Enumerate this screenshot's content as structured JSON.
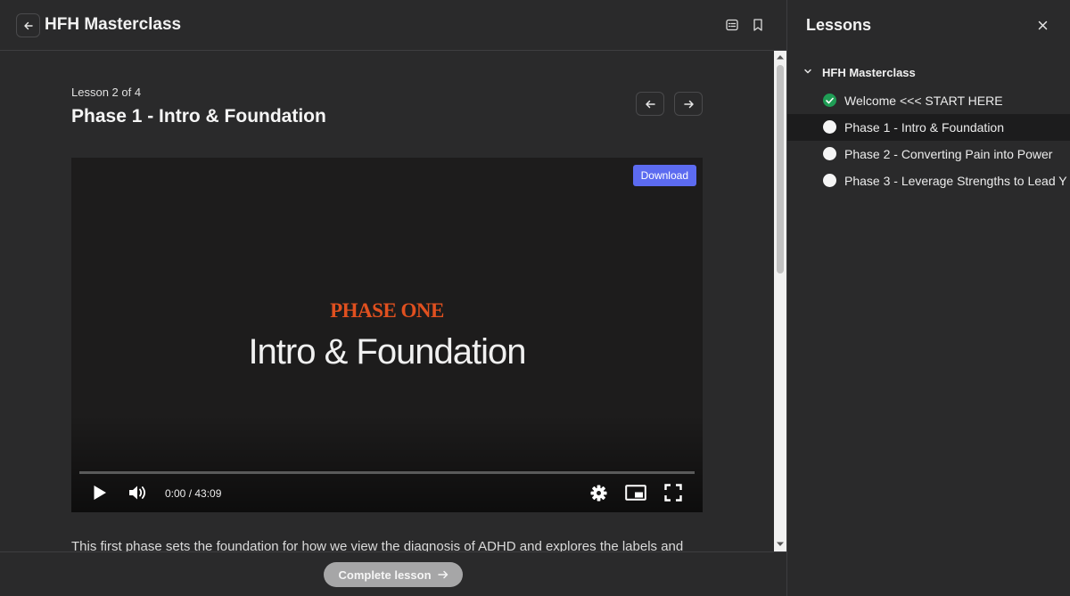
{
  "header": {
    "course_title": "HFH Masterclass"
  },
  "lesson": {
    "counter": "Lesson 2 of 4",
    "title": "Phase 1 - Intro & Foundation",
    "description": "This first phase sets the foundation for how we view the diagnosis of ADHD and explores the labels and"
  },
  "video": {
    "download_label": "Download",
    "phase_label": "PHASE ONE",
    "title": "Intro & Foundation",
    "time": "0:00 / 43:09",
    "progress": 0
  },
  "footer": {
    "complete_label": "Complete lesson"
  },
  "sidebar": {
    "title": "Lessons",
    "section_title": "HFH Masterclass",
    "lessons": [
      {
        "label": "Welcome <<< START HERE",
        "completed": true
      },
      {
        "label": "Phase 1 - Intro & Foundation",
        "completed": false,
        "active": true
      },
      {
        "label": "Phase 2 - Converting Pain into Power",
        "completed": false
      },
      {
        "label": "Phase 3 - Leverage Strengths to Lead Y",
        "completed": false
      }
    ]
  },
  "colors": {
    "background": "#2a2a2b",
    "accent_download": "#5c6bf0",
    "phase_orange": "#e0501f",
    "completed_green": "#1f9d55"
  },
  "icons": {
    "back": "arrow-left-icon",
    "notes": "notes-icon",
    "bookmark": "bookmark-icon",
    "prev": "arrow-left-icon",
    "next": "arrow-right-icon",
    "play": "play-icon",
    "volume": "volume-icon",
    "settings": "gear-icon",
    "pip": "picture-in-picture-icon",
    "fullscreen": "fullscreen-icon",
    "close": "close-icon",
    "chevron": "chevron-down-icon"
  }
}
